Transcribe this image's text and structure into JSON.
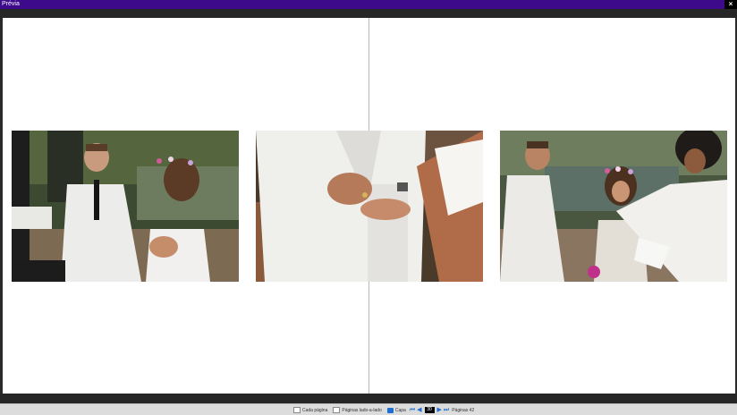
{
  "window": {
    "title": "Prévia",
    "close_glyph": "×"
  },
  "spread": {
    "photos": [
      {
        "name": "photo-groom-with-microphone"
      },
      {
        "name": "photo-ring-exchange-closeup"
      },
      {
        "name": "photo-couple-with-officiant"
      }
    ]
  },
  "statusbar": {
    "single_page_label": "Cada página",
    "side_by_side_label": "Páginas lado-a-lado",
    "cover_label": "Capa",
    "current_page": "30",
    "pages_label": "Páginas 42"
  },
  "colors": {
    "titlebar": "#3c0a8a",
    "accent": "#1f6fd0"
  }
}
